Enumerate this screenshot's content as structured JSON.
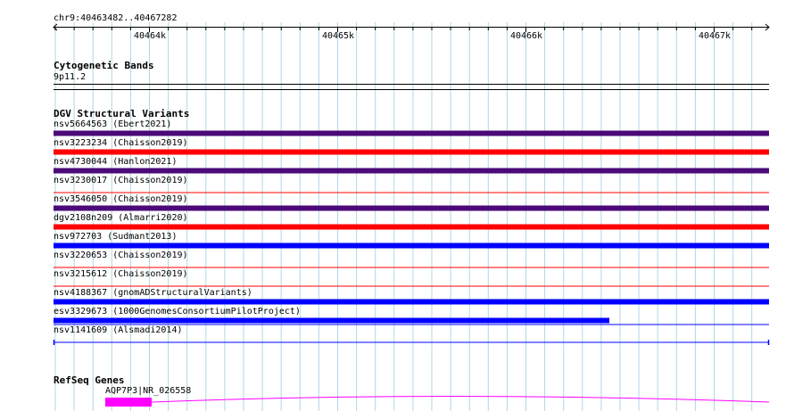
{
  "location": "chr9:40463482..40467282",
  "ruler": {
    "ticks": [
      "40464k",
      "40465k",
      "40466k",
      "40467k"
    ]
  },
  "tracks": {
    "cytoband": {
      "title": "Cytogenetic Bands",
      "band": "9p11.2"
    },
    "dgv": {
      "title": "DGV Structural Variants",
      "features": [
        {
          "label": "nsv5664563 (Ebert2021)",
          "color": "#4b0a78",
          "style": "thick",
          "span": "full"
        },
        {
          "label": "nsv3223234 (Chaisson2019)",
          "color": "#ff0000",
          "style": "thick",
          "span": "full"
        },
        {
          "label": "nsv4730044 (Hanlon2021)",
          "color": "#4b0a78",
          "style": "thick",
          "span": "full"
        },
        {
          "label": "nsv3230017 (Chaisson2019)",
          "color": "#ff0000",
          "style": "thin",
          "span": "full"
        },
        {
          "label": "nsv3546050 (Chaisson2019)",
          "color": "#4b0a78",
          "style": "thick",
          "span": "full"
        },
        {
          "label": "dgv2108n209 (Almarri2020)",
          "color": "#ff0000",
          "style": "thick",
          "span": "full"
        },
        {
          "label": "nsv972703 (Sudmant2013)",
          "color": "#0000ff",
          "style": "thick",
          "span": "full"
        },
        {
          "label": "nsv3220653 (Chaisson2019)",
          "color": "#ff0000",
          "style": "thin",
          "span": "full"
        },
        {
          "label": "nsv3215612 (Chaisson2019)",
          "color": "#ff0000",
          "style": "thin",
          "span": "full"
        },
        {
          "label": "nsv4188367 (gnomADStructuralVariants)",
          "color": "#0000ff",
          "style": "thick",
          "span": "full"
        },
        {
          "label": "esv3329673 (1000GenomesConsortiumPilotProject)",
          "color": "#0000ff",
          "style": "thick-partial",
          "span": "partial"
        },
        {
          "label": "nsv1141609 (Alsmadi2014)",
          "color": "#0000ff",
          "style": "thin-capped",
          "span": "full"
        }
      ]
    },
    "refseq": {
      "title": "RefSeq Genes",
      "gene_label": "AQP7P3|NR_026558",
      "color": "#ff00ff"
    }
  },
  "colors": {
    "gridline": "#add8e6",
    "ruler": "#000000"
  }
}
